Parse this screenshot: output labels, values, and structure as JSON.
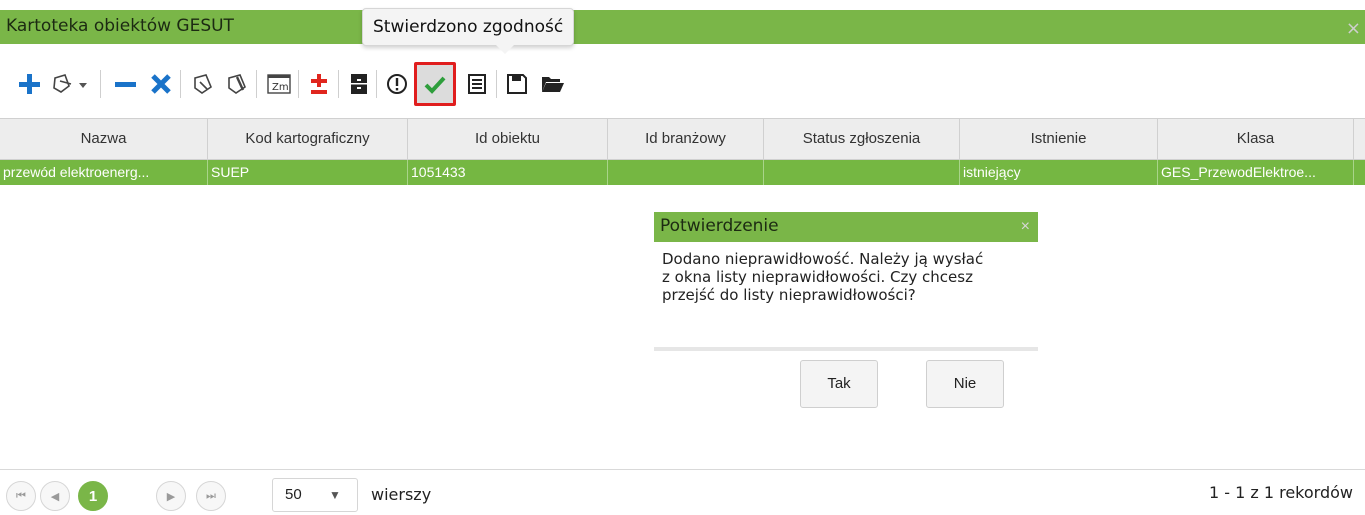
{
  "window": {
    "title": "Kartoteka obiektów GESUT",
    "close": "×"
  },
  "tooltip": {
    "text": "Stwierdzono zgodność"
  },
  "toolbar": {
    "buttons": [
      {
        "name": "add",
        "icon": "plus-icon",
        "color": "#1a73c9"
      },
      {
        "name": "edit-geometry",
        "icon": "edit-geometry-icon"
      },
      {
        "name": "remove",
        "icon": "minus-icon",
        "color": "#1a73c9"
      },
      {
        "name": "delete",
        "icon": "x-icon",
        "color": "#1a73c9"
      },
      {
        "name": "edit-attributes",
        "icon": "pencil-icon"
      },
      {
        "name": "edit-attributes-2",
        "icon": "pencil-icon"
      },
      {
        "name": "zm",
        "icon": "zm-icon",
        "label": "Zm"
      },
      {
        "name": "plus-minus",
        "icon": "plus-minus-icon",
        "color": "#e0261e"
      },
      {
        "name": "archive",
        "icon": "cabinet-icon"
      },
      {
        "name": "warning",
        "icon": "exclamation-icon"
      },
      {
        "name": "confirm",
        "icon": "check-icon",
        "color": "#2e9e3c"
      },
      {
        "name": "list",
        "icon": "list-icon"
      },
      {
        "name": "save",
        "icon": "save-icon"
      },
      {
        "name": "open",
        "icon": "folder-icon"
      }
    ]
  },
  "table": {
    "columns": [
      "Nazwa",
      "Kod kartograficzny",
      "Id obiektu",
      "Id branżowy",
      "Status zgłoszenia",
      "Istnienie",
      "Klasa"
    ],
    "rows": [
      [
        "przewód elektroenerg...",
        "SUEP",
        "1051433",
        "",
        "",
        "istniejący",
        "GES_PrzewodElektroe..."
      ]
    ],
    "selected_row_color": "#75b742"
  },
  "dialog": {
    "title": "Potwierdzenie",
    "close": "×",
    "message_lines": [
      "Dodano nieprawidłowość. Należy ją wysłać",
      "z okna listy nieprawidłowości. Czy chcesz",
      "przejść do listy nieprawidłowości?"
    ],
    "yes_label": "Tak",
    "no_label": "Nie"
  },
  "pager": {
    "current_page": "1",
    "page_size": "50",
    "page_size_arrow": "▼",
    "rows_label": "wierszy",
    "info": "1 - 1 z 1 rekordów",
    "first": "⏮",
    "prev": "◀",
    "next": "▶",
    "last": "⏭"
  },
  "accent_color": "#7ab648"
}
